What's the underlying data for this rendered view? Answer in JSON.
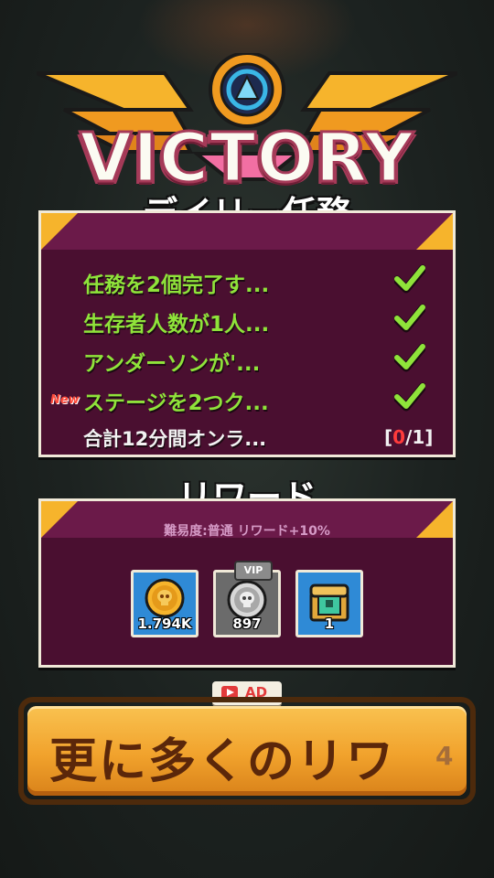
{
  "banner": {
    "title": "VICTORY"
  },
  "daily": {
    "title": "デイリー任務",
    "missions": [
      {
        "label": "任務を2個完了す...",
        "done": true
      },
      {
        "label": "生存者人数が1人...",
        "done": true
      },
      {
        "label": "アンダーソンが'...",
        "done": true
      },
      {
        "label": "ステージを2つク...",
        "done": true,
        "badge": "New"
      },
      {
        "label": "合計12分間オンラ...",
        "done": false,
        "progress_current": "0",
        "progress_total": "/1"
      }
    ]
  },
  "reward": {
    "title": "リワード",
    "difficulty": "難易度:普通 リワード+10%",
    "items": [
      {
        "icon": "gold-skull-coin-icon",
        "value": "1.794K"
      },
      {
        "icon": "silver-skull-coin-icon",
        "value": "897",
        "tag": "VIP"
      },
      {
        "icon": "treasure-chest-icon",
        "value": "1"
      }
    ]
  },
  "ad": {
    "label": "AD"
  },
  "more_button": {
    "label": "更に多くのリワ",
    "count": "4"
  },
  "colors": {
    "panel": "#4a0f30",
    "panel_header": "#6b1a49",
    "accent_gold": "#f6b42c",
    "done_green": "#8fe33a",
    "alert_red": "#ff3b3b"
  }
}
